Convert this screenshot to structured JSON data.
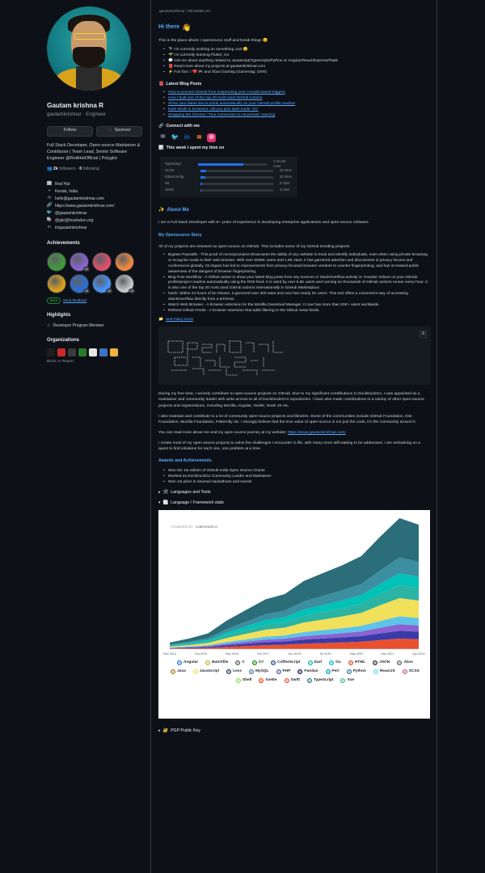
{
  "profile": {
    "name": "Gautam krishna R",
    "handle": "gautamkrishnar · Engineer",
    "follow_label": "Follow",
    "sponsor_label": "Sponsor",
    "bio": "Full Stack Developer, Open-source Maintainer & Contributor | Team Lead, Senior Software Engineer @RedHatOfficial | Polyglot",
    "followers_count": "2k",
    "followers_label": "followers",
    "following_count": "0",
    "following_label": "following",
    "info": [
      {
        "icon": "org-icon",
        "text": "Red Hat"
      },
      {
        "icon": "location-icon",
        "text": "Kerala, India"
      },
      {
        "icon": "mail-icon",
        "text": "hello@gautamkrishnar.com"
      },
      {
        "icon": "link-icon",
        "text": "https://www.gautamkrishnar.com/"
      },
      {
        "icon": "twitter-icon",
        "text": "@gautamkrishnar"
      },
      {
        "icon": "mastodon-icon",
        "text": "@gkr@fosstodon.org"
      },
      {
        "icon": "linkedin-icon",
        "text": "in/gautamkrishnar"
      }
    ]
  },
  "achievements": {
    "title": "Achievements",
    "badges": [
      {
        "color": "#3e9b3a",
        "count": ""
      },
      {
        "color": "#8a63d2",
        "count": "x2"
      },
      {
        "color": "#e24e6b",
        "count": ""
      },
      {
        "color": "#f0883e",
        "count": ""
      },
      {
        "color": "#d9a21b",
        "count": ""
      },
      {
        "color": "#2a6fdb",
        "count": "x3"
      },
      {
        "color": "#4493f8",
        "count": "x3"
      },
      {
        "color": "#c7c7c7",
        "count": "x3"
      }
    ],
    "beta_label": "Beta",
    "feedback_label": "Send feedback"
  },
  "highlights": {
    "title": "Highlights",
    "item": "Developer Program Member"
  },
  "organizations": {
    "title": "Organizations",
    "colors": [
      "#1f1f1f",
      "#cc2929",
      "#3b3b3b",
      "#2a7a2a",
      "#e6e6e6",
      "#3f72c4",
      "#f2b13c"
    ],
    "report_label": "Block or Report"
  },
  "readme": {
    "path": "gautamkrishnar / README.md",
    "greeting": "Hi there",
    "intro": "This is the place where I opensource stuff and break things 😉",
    "about_items": [
      "🔭 I'm currently working on something cool 😉",
      "🌱 I'm currently learning Flutter, Go",
      "💬 Ask me about anything related to Javascript(Typescript)/Python or Angular/React/Express/Flask",
      "📕 Read more about my projects at gautamkrishnar.com",
      "⚡ Fun fact: I ❤️ 🎮 and Xbox Gaming (Gamertag: GKR)"
    ],
    "blog_title": "Latest Blog Posts",
    "blog_posts": [
      "How to prevent GitHub from suspending your cronjob based triggers",
      "How I built one of the top 30 most used GitHub Actions",
      "Show your latest dev.to posts automatically on your GitHub profile readme",
      "Dark Mode in browsers: did you pick dark-mode \"on\"",
      "Snapping the Chrome \"Your connection is not private\" warning"
    ],
    "connect_title": "Connect with me",
    "week_title": "This week I spent my time on",
    "wakatime": [
      {
        "lang": "TypeScript",
        "pct": 0.65,
        "time": "2 hrs 58 mins"
      },
      {
        "lang": "SCSS",
        "pct": 0.08,
        "time": "23 mins"
      },
      {
        "lang": "EditorConfig",
        "pct": 0.07,
        "time": "20 mins"
      },
      {
        "lang": "INI",
        "pct": 0.02,
        "time": "6 mins"
      },
      {
        "lang": "JSON",
        "pct": 0.01,
        "time": "3 mins"
      }
    ],
    "about_title": "About Me",
    "about_text": "I am a Full Stack Developer with 8+ years of experience in developing enterprise applications and open-source software.",
    "oss_title": "My Opensource Story",
    "oss_intro": "All of my projects are released as open-source on GitHub. This includes some of my GitHub trending projects:",
    "oss_items": [
      "Bypass Paywalls - This proof of concept project showcases the ability of any website to track and identify individuals, even when using private browsing or incognito mode in their web browser. With over 5000K users and 1.8K stars, it has garnered attention and discussions in privacy forums and conferences globally. Its impact has led to improvements from privacy-focused browser vendors to counter fingerprinting, and has increased public awareness of the dangers of browser fingerprinting.",
      "Blog Post Workflow - A Github action to show your latest blog posts from any sources or StackOverflow activity or Youtube Videos on your GitHub profile/project readme automatically using the RSS feed. It is used by over 5.6K users and running on thousands of GitHub actions runner every hour. It is also one of the top 20 most used GitHub actions internationally in GitHub Marketplace.",
      "hashi: Within 24 hours of its release, it garnered over 300 stars and now has nearly 2K users. This tool offers a convenient way of accessing StackOverflow directly from a terminal.",
      "Watch Web Browser - A browser extension for the Mozilla Download Manager. It now has more than 20K+ users worldwide.",
      "Refined Github Feeds - A browser extension that adds filtering to the Github news feeds."
    ],
    "more_label": "and many more",
    "oss_p1": "During my free time, I actively contribute to open-source projects on GitHub. Due to my significant contributions to DuckDuckGo, I was appointed as a maintainer and community leader with write access to all of DuckDuckGo's repositories. I have also made contributions to a variety of other open-source projects and organizations, including Mozilla, Angular, Svelte, Node JS etc.",
    "oss_p2": "I also maintain and contribute to a lot of community open-source projects and libraries. Some of the communities include GitHub Foundation, Kite Foundation, Mozilla Foundation, Patternfly etc. I strongly believe that the true value of open-source is not just the code, it's the community around it.",
    "oss_p3": "You can read more about me and my open source journey at my website:",
    "oss_p3_link": "https://www.gautamkrishnar.com/",
    "oss_p4": "I create most of my open source projects to solve the challenges I encounter in life, with many more still waiting to be addressed. I am embarking on a quest to find solutions for each one, one problem at a time.",
    "awards_title": "Awards and Achievements",
    "awards": [
      "Won the 1st edition of GitHub India Open Source Grants",
      "Worked as DuckDuckGo Community Leader and Maintainer",
      "Won 1st prize in Several Hackathons and events"
    ],
    "languages_summary": "Languages and Tools",
    "framework_summary": "Language / Framework stats",
    "pgp_summary": "PGP Public Key"
  },
  "chart_data": {
    "type": "area",
    "powered_by": "POWERED BY",
    "brand": "codersrank.io",
    "x": [
      "Dec 2014",
      "Oct 2015",
      "Sep 2016",
      "Oct 2017",
      "Jun 2018",
      "Jul 2019",
      "May 2020",
      "Mar 2021",
      "Apr 2022"
    ],
    "stacked_profile": [
      0.05,
      0.08,
      0.12,
      0.22,
      0.3,
      0.38,
      0.42,
      0.52,
      0.58,
      0.64,
      0.71,
      0.86,
      1.0,
      0.95
    ],
    "series": [
      {
        "name": "Angular",
        "color": "#1f6feb"
      },
      {
        "name": "Batchfile",
        "color": "#c2b33e"
      },
      {
        "name": "C",
        "color": "#555555"
      },
      {
        "name": "C#",
        "color": "#178600"
      },
      {
        "name": "CoffeeScript",
        "color": "#244776"
      },
      {
        "name": "Dart",
        "color": "#00b4ab"
      },
      {
        "name": "Go",
        "color": "#00add8"
      },
      {
        "name": "HTML",
        "color": "#e34c26"
      },
      {
        "name": "JSON",
        "color": "#292929"
      },
      {
        "name": "JSon",
        "color": "#5a5a5a"
      },
      {
        "name": "Java",
        "color": "#b07219"
      },
      {
        "name": "JavaScript",
        "color": "#f1e05a"
      },
      {
        "name": "Less",
        "color": "#1d365d"
      },
      {
        "name": "MySQL",
        "color": "#4479a1"
      },
      {
        "name": "PHP",
        "color": "#4f5d95"
      },
      {
        "name": "Pandas",
        "color": "#150458"
      },
      {
        "name": "Perl",
        "color": "#0298c3"
      },
      {
        "name": "Python",
        "color": "#3572a5"
      },
      {
        "name": "ReactJS",
        "color": "#61dafb"
      },
      {
        "name": "SCSS",
        "color": "#c6538c"
      },
      {
        "name": "Shell",
        "color": "#89e051"
      },
      {
        "name": "Svelte",
        "color": "#ff3e00"
      },
      {
        "name": "Swift",
        "color": "#f05138"
      },
      {
        "name": "TypeScript",
        "color": "#2b7489"
      },
      {
        "name": "Vue",
        "color": "#41b883"
      }
    ]
  }
}
